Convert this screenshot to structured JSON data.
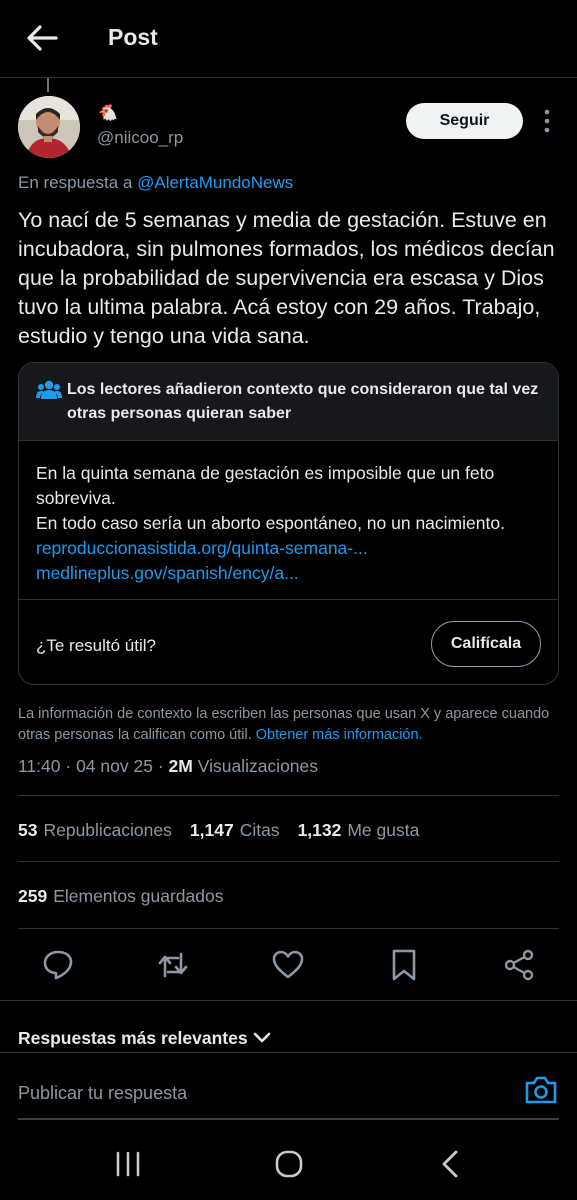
{
  "header": {
    "title": "Post"
  },
  "author": {
    "display_name": "🐔",
    "handle": "@niicoo_rp"
  },
  "follow_label": "Seguir",
  "reply_to": {
    "prefix": "En respuesta a",
    "mention": "@AlertaMundoNews"
  },
  "tweet_text": "Yo nací de 5 semanas y media de gestación. Estuve en incubadora, sin pulmones formados, los médicos decían que la probabilidad de supervivencia era escasa y Dios tuvo la ultima palabra. Acá estoy con 29 años. Trabajo, estudio y tengo una vida sana.",
  "community_note": {
    "heading": "Los lectores añadieron contexto que consideraron que tal vez otras personas quieran saber",
    "body_line1": "En la quinta semana de gestación es imposible que un feto sobreviva.",
    "body_line2": "En todo caso sería un aborto espontáneo, no un nacimiento.",
    "link1": "reproduccionasistida.org/quinta-semana-...",
    "link2": "medlineplus.gov/spanish/ency/a...",
    "helpful_question": "¿Te resultó útil?",
    "rate_label": "Califícala"
  },
  "disclaimer": {
    "text": "La información de contexto la escriben las personas que usan X y aparece cuando otras personas la califican como útil.",
    "link": "Obtener más información."
  },
  "meta": {
    "time": "11:40",
    "date": "04 nov 25",
    "views_count": "2M",
    "views_label": "Visualizaciones"
  },
  "stats": [
    {
      "count": "53",
      "label": "Republicaciones"
    },
    {
      "count": "1,147",
      "label": "Citas"
    },
    {
      "count": "1,132",
      "label": "Me gusta"
    }
  ],
  "saved": {
    "count": "259",
    "label": "Elementos guardados"
  },
  "actions": [
    "reply-icon",
    "retweet-icon",
    "like-icon",
    "bookmark-icon",
    "share-icon"
  ],
  "replies_sort": "Respuestas más relevantes",
  "reply_placeholder": "Publicar tu respuesta",
  "colors": {
    "accent": "#1d9bf0",
    "background": "#000000",
    "text": "#e7e9ea",
    "muted": "#8b98a5"
  }
}
